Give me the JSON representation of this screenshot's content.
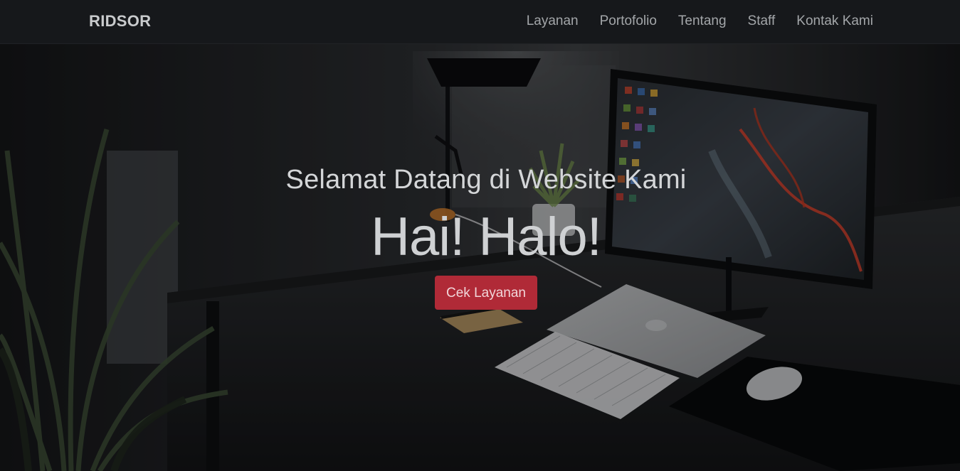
{
  "navbar": {
    "brand": "RIDSOR",
    "links": [
      {
        "label": "Layanan"
      },
      {
        "label": "Portofolio"
      },
      {
        "label": "Tentang"
      },
      {
        "label": "Staff"
      },
      {
        "label": "Kontak Kami"
      }
    ]
  },
  "hero": {
    "subtitle": "Selamat Datang di Website Kami",
    "headline": "Hai! Halo!",
    "cta_label": "Cek Layanan"
  },
  "colors": {
    "navbar_bg": "#16181b",
    "brand_text": "#c9cbcd",
    "nav_link": "#a3a6a9",
    "cta_bg": "#b02a37"
  }
}
